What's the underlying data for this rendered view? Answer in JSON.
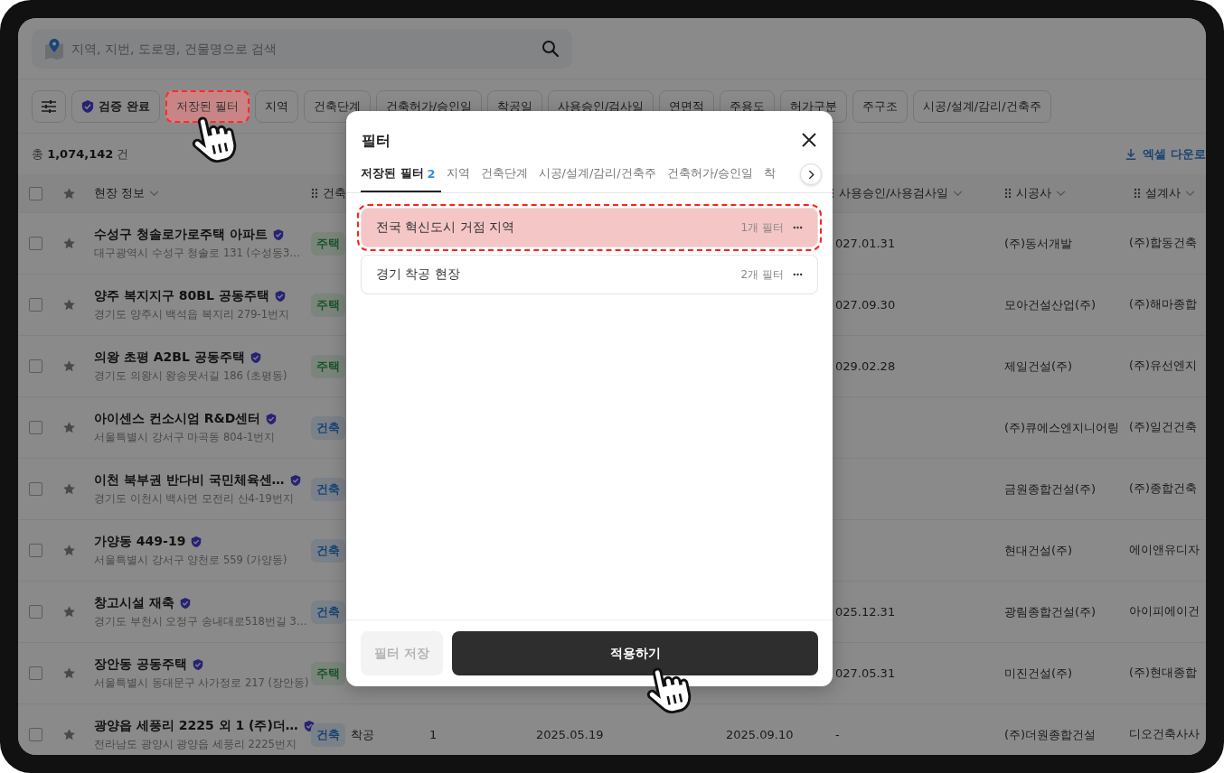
{
  "search": {
    "placeholder": "지역, 지번, 도로명, 건물명으로 검색"
  },
  "chips": [
    {
      "label": "검증 완료",
      "kind": "verified",
      "highlighted": false
    },
    {
      "label": "저장된 필터",
      "kind": "plain",
      "highlighted": true
    },
    {
      "label": "지역",
      "kind": "plain",
      "highlighted": false
    },
    {
      "label": "건축단계",
      "kind": "plain",
      "highlighted": false
    },
    {
      "label": "건축허가/승인일",
      "kind": "plain",
      "highlighted": false
    },
    {
      "label": "착공일",
      "kind": "plain",
      "highlighted": false
    },
    {
      "label": "사용승인/검사일",
      "kind": "plain",
      "highlighted": false
    },
    {
      "label": "연면적",
      "kind": "plain",
      "highlighted": false
    },
    {
      "label": "주용도",
      "kind": "plain",
      "highlighted": false
    },
    {
      "label": "허가구분",
      "kind": "plain",
      "highlighted": false
    },
    {
      "label": "주구조",
      "kind": "plain",
      "highlighted": false
    },
    {
      "label": "시공/설계/감리/건축주",
      "kind": "plain",
      "highlighted": false
    }
  ],
  "total": "총 **1,074,142** 건",
  "download": "엑셀 다운로",
  "table": {
    "all_checked": false,
    "columns": [
      {
        "label": "현장 정보",
        "draggable": false,
        "menu": true
      },
      {
        "label": "건축",
        "draggable": true,
        "menu": false
      },
      {
        "label": "사용승인/사용검사일",
        "draggable": true,
        "menu": true
      },
      {
        "label": "시공사",
        "draggable": true,
        "menu": true
      },
      {
        "label": "설계사",
        "draggable": true,
        "menu": true
      }
    ],
    "rows": [
      {
        "checked": false,
        "starred": false,
        "name": "수성구 청솔로가로주택 아파트",
        "verified": true,
        "address": "대구광역시 수성구 청솔로 131 (수성동3…",
        "tag": {
          "label": "주택",
          "kind": "housing"
        },
        "approval": "027.01.31",
        "builder": "(주)동서개발",
        "designer": "(주)합동건축"
      },
      {
        "checked": false,
        "starred": false,
        "name": "양주 복지지구 80BL 공동주택",
        "verified": true,
        "address": "경기도 양주시 백석읍 복지리 279-1번지",
        "tag": {
          "label": "주택",
          "kind": "housing"
        },
        "approval": "027.09.30",
        "builder": "모아건설산업(주)",
        "designer": "(주)해마종합"
      },
      {
        "checked": false,
        "starred": false,
        "name": "의왕 초평 A2BL 공동주택",
        "verified": true,
        "address": "경기도 의왕시 왕송못서길 186 (초평동)",
        "tag": {
          "label": "주택",
          "kind": "housing"
        },
        "approval": "029.02.28",
        "builder": "제일건설(주)",
        "designer": "(주)유선엔지"
      },
      {
        "checked": false,
        "starred": false,
        "name": "아이센스 컨소시엄 R&D센터",
        "verified": true,
        "address": "서울특별시 강서구 마곡동 804-1번지",
        "tag": {
          "label": "건축",
          "kind": "building"
        },
        "builder": "(주)큐에스엔지니어링",
        "designer": "(주)일건건축"
      },
      {
        "checked": false,
        "starred": false,
        "name": "이천 북부권 반다비 국민체육센…",
        "verified": true,
        "address": "경기도 이천시 백사면 모전리 산4-19번지",
        "tag": {
          "label": "건축",
          "kind": "building"
        },
        "builder": "금원종합건설(주)",
        "designer": "(주)종합건축"
      },
      {
        "checked": false,
        "starred": false,
        "name": "가양동 449-19",
        "verified": true,
        "address": "서울특별시 강서구 양천로 559 (가양동)",
        "tag": {
          "label": "건축",
          "kind": "building"
        },
        "builder": "현대건설(주)",
        "designer": "에이앤유디자"
      },
      {
        "checked": false,
        "starred": false,
        "name": "창고시설 재축",
        "verified": true,
        "address": "경기도 부천시 오정구 송내대로518번길 3…",
        "tag": {
          "label": "건축",
          "kind": "building"
        },
        "approval": "025.12.31",
        "builder": "광림종합건설(주)",
        "designer": "아이피에이건"
      },
      {
        "checked": false,
        "starred": false,
        "name": "장안동 공동주택",
        "verified": true,
        "address": "서울특별시 동대문구 사가정로 217 (장안동)",
        "tag": {
          "label": "주택",
          "kind": "housing"
        },
        "approval": "027.05.31",
        "builder": "미진건설(주)",
        "designer": "(주)현대종합"
      },
      {
        "checked": false,
        "starred": false,
        "name": "광양읍 세풍리 2225 외 1 (주)더…",
        "verified": true,
        "address": "전라남도 광양시 광양읍 세풍리 2225번지",
        "tag": {
          "label": "건축",
          "kind": "building"
        },
        "stage": "착공",
        "count": "1",
        "start": "2025.05.19",
        "end": "2025.09.10",
        "approval": "-",
        "builder": "(주)더원종합건설",
        "designer": "디오건축사사"
      }
    ]
  },
  "modal": {
    "title": "필터",
    "tabs": [
      {
        "label": "저장된 필터",
        "count": "2",
        "selected": true
      },
      {
        "label": "지역",
        "selected": false
      },
      {
        "label": "건축단계",
        "selected": false
      },
      {
        "label": "시공/설계/감리/건축주",
        "selected": false
      },
      {
        "label": "건축허가/승인일",
        "selected": false
      },
      {
        "label": "착",
        "selected": false
      }
    ],
    "saved_filters": [
      {
        "name": "전국 혁신도시 거점 지역",
        "count": "1개 필터",
        "highlighted": true
      },
      {
        "name": "경기 착공 현장",
        "count": "2개 필터",
        "highlighted": false
      }
    ],
    "save_button": {
      "label": "필터 저장",
      "disabled": true
    },
    "apply_button": {
      "label": "적용하기",
      "disabled": false
    }
  }
}
